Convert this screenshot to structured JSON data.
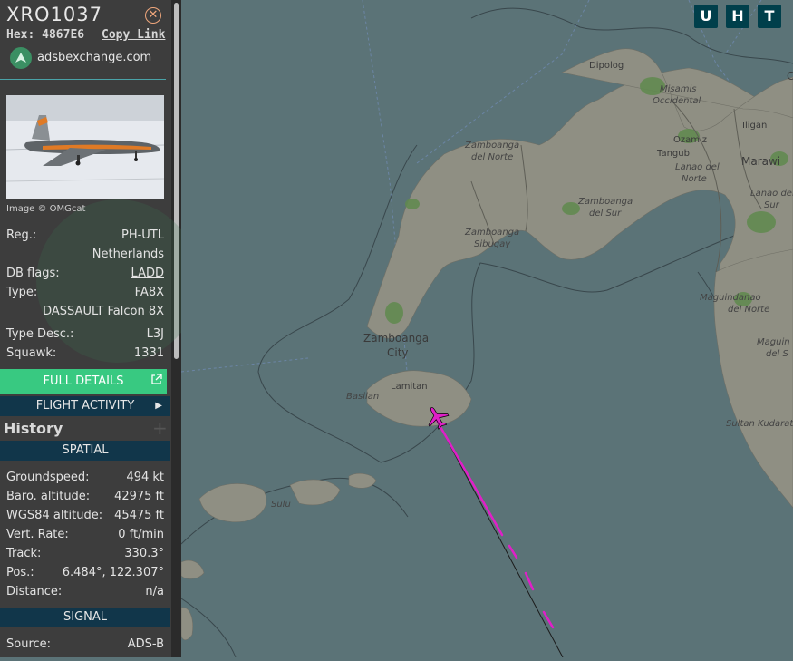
{
  "aircraft": {
    "callsign": "XRO1037",
    "hex_label": "Hex:",
    "hex": "4867E6",
    "copy_link": "Copy Link",
    "site": "adsbexchange.com",
    "image_credit": "Image © OMGcat"
  },
  "details": {
    "reg_label": "Reg.:",
    "reg": "PH-UTL",
    "country": "Netherlands",
    "dbflags_label": "DB flags:",
    "dbflags": "LADD",
    "type_label": "Type:",
    "type": "FA8X",
    "type_name": "DASSAULT Falcon 8X",
    "typedesc_label": "Type Desc.:",
    "typedesc": "L3J",
    "squawk_label": "Squawk:",
    "squawk": "1331"
  },
  "buttons": {
    "full_details": "FULL DETAILS",
    "flight_activity": "FLIGHT ACTIVITY",
    "history": "History",
    "history_plus": "+"
  },
  "spatial": {
    "title": "SPATIAL",
    "groundspeed_label": "Groundspeed:",
    "groundspeed": "494 kt",
    "baro_label": "Baro. altitude:",
    "baro": "42975 ft",
    "wgs_label": "WGS84 altitude:",
    "wgs": "45475 ft",
    "vert_label": "Vert. Rate:",
    "vert": "0 ft/min",
    "track_label": "Track:",
    "track": "330.3°",
    "pos_label": "Pos.:",
    "pos": "6.484°, 122.307°",
    "dist_label": "Distance:",
    "dist": "n/a"
  },
  "signal": {
    "title": "SIGNAL",
    "source_label": "Source:",
    "source": "ADS-B"
  },
  "map_buttons": {
    "u": "U",
    "h": "H",
    "t": "T"
  },
  "map_labels": {
    "dipolog": "Dipolog",
    "misamis1": "Misamis",
    "misamis2": "Occidental",
    "iligan": "Iligan",
    "ozamiz": "Ozamiz",
    "tangub": "Tangub",
    "marawi": "Marawi",
    "lanao1": "Lanao del",
    "lanao2": "Norte",
    "lanaosur1": "Lanao del",
    "lanaosur2": "Sur",
    "zdn1": "Zamboanga",
    "zdn2": "del Norte",
    "zds1": "Zamboanga",
    "zds2": "del Sur",
    "zsib1": "Zamboanga",
    "zsib2": "Sibugay",
    "zcity1": "Zamboanga",
    "zcity2": "City",
    "lamitan": "Lamitan",
    "basilan": "Basilan",
    "sulu": "Sulu",
    "magn1": "Maguindanao",
    "magn2": "del Norte",
    "mags1": "Maguin",
    "mags2": "del S",
    "sultan": "Sultan Kudarat",
    "edge_c": "C"
  },
  "colors": {
    "sidebar": "#3d3d3d",
    "accent_green": "#38c981",
    "section_bar": "#11364a",
    "sea": "#5b7377",
    "land": "#8f8f83",
    "track": "#e01fc8"
  },
  "icons": [
    "close-icon",
    "adsbx-logo-icon",
    "external-link-icon",
    "chevron-right-icon",
    "plus-icon",
    "airplane-icon"
  ]
}
